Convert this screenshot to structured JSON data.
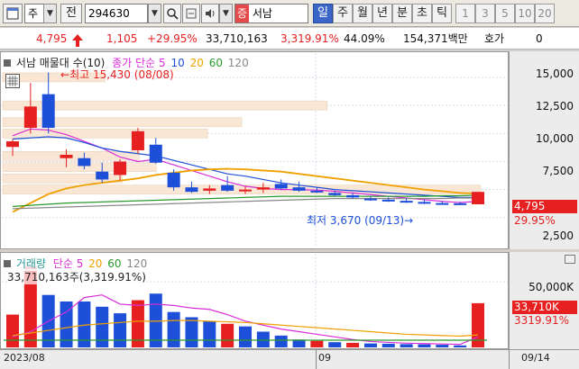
{
  "toolbar": {
    "type_label": "주",
    "history_label": "전",
    "code": "294630",
    "stock_badge": "증",
    "stock_name": "서남",
    "periods": [
      "일",
      "주",
      "월",
      "년",
      "분",
      "초",
      "틱"
    ],
    "active_period": "일",
    "minute_options": [
      "1",
      "3",
      "5",
      "10",
      "20"
    ],
    "icons": [
      "window-icon",
      "search-icon",
      "magnifier-icon",
      "sound-icon"
    ]
  },
  "quote": {
    "price": "4,795",
    "direction": "up",
    "change": "1,105",
    "change_pct": "+29.95%",
    "volume": "33,710,163",
    "volume_ratio": "3,319.91%",
    "turnover_pct": "44.09%",
    "trade_value": "154,371백만",
    "bid_ask_label": "호가",
    "bid_ask_value": "0"
  },
  "colors": {
    "up": "#e62020",
    "down": "#1d4fd8",
    "ma5": "#d82cd8",
    "ma10": "#1d4fd8",
    "ma20": "#f0a000",
    "ma60": "#2a9a2a",
    "ma120": "#888888"
  },
  "price_chart": {
    "legend": {
      "name": "서남 매물대",
      "count_label": "수(10)",
      "ma_prefix": "종가 단순",
      "ma_periods": [
        "5",
        "10",
        "20",
        "60",
        "120"
      ]
    },
    "high_annotation": "최고 15,430 (08/08)",
    "low_annotation": "최저 3,670 (09/13)",
    "y_ticks": [
      "15,000",
      "12,500",
      "10,000",
      "7,500",
      "2,500"
    ],
    "current_price_tag": "4,795",
    "current_pct_tag": "29.95%"
  },
  "volume_chart": {
    "legend": {
      "title": "거래량",
      "ma_prefix": "단순",
      "ma_periods": [
        "5",
        "20",
        "60",
        "120"
      ]
    },
    "info": "33,710,163주(3,319.91%)",
    "y_ticks": [
      "50,000K"
    ],
    "current_volume_tag": "33,710K",
    "current_pct_tag": "3319.91%"
  },
  "date_axis": [
    "2023/08",
    "09",
    "09/14"
  ],
  "chart_data": [
    {
      "type": "candlestick",
      "title": "서남",
      "ylim": [
        0,
        17000
      ],
      "y_ticks": [
        2500,
        5000,
        7500,
        10000,
        12500,
        15000
      ],
      "candles": [
        {
          "o": 8800,
          "h": 9500,
          "l": 8000,
          "c": 9300
        },
        {
          "o": 10500,
          "h": 14500,
          "l": 10000,
          "c": 12400
        },
        {
          "o": 13500,
          "h": 15430,
          "l": 10000,
          "c": 10500
        },
        {
          "o": 7800,
          "h": 8600,
          "l": 7000,
          "c": 8100
        },
        {
          "o": 7800,
          "h": 8300,
          "l": 6800,
          "c": 7100
        },
        {
          "o": 6600,
          "h": 7400,
          "l": 5600,
          "c": 5900
        },
        {
          "o": 6300,
          "h": 7700,
          "l": 5800,
          "c": 7500
        },
        {
          "o": 8500,
          "h": 10500,
          "l": 8200,
          "c": 10200
        },
        {
          "o": 9000,
          "h": 9600,
          "l": 7300,
          "c": 7400
        },
        {
          "o": 6500,
          "h": 6800,
          "l": 4900,
          "c": 5200
        },
        {
          "o": 5200,
          "h": 5700,
          "l": 4700,
          "c": 4800
        },
        {
          "o": 4900,
          "h": 5400,
          "l": 4600,
          "c": 5100
        },
        {
          "o": 5400,
          "h": 6200,
          "l": 4800,
          "c": 4900
        },
        {
          "o": 4900,
          "h": 5300,
          "l": 4600,
          "c": 5000
        },
        {
          "o": 5000,
          "h": 5600,
          "l": 4700,
          "c": 5200
        },
        {
          "o": 5500,
          "h": 5900,
          "l": 5000,
          "c": 5100
        },
        {
          "o": 5200,
          "h": 5700,
          "l": 4800,
          "c": 4900
        },
        {
          "o": 4900,
          "h": 5200,
          "l": 4700,
          "c": 4800
        },
        {
          "o": 4700,
          "h": 4900,
          "l": 4400,
          "c": 4500
        },
        {
          "o": 4500,
          "h": 4700,
          "l": 4200,
          "c": 4300
        },
        {
          "o": 4200,
          "h": 4400,
          "l": 4000,
          "c": 4100
        },
        {
          "o": 4100,
          "h": 4300,
          "l": 3900,
          "c": 4000
        },
        {
          "o": 4000,
          "h": 4200,
          "l": 3800,
          "c": 3900
        },
        {
          "o": 3900,
          "h": 4100,
          "l": 3700,
          "c": 3800
        },
        {
          "o": 3800,
          "h": 4000,
          "l": 3700,
          "c": 3750
        },
        {
          "o": 3780,
          "h": 3900,
          "l": 3670,
          "c": 3690
        },
        {
          "o": 3690,
          "h": 4795,
          "l": 3690,
          "c": 4795
        }
      ],
      "ma": {
        "5": [
          9800,
          10400,
          10300,
          9900,
          9300,
          8700,
          7900,
          7500,
          7700,
          7200,
          6700,
          6200,
          5700,
          5300,
          5100,
          5000,
          5000,
          4950,
          4850,
          4700,
          4550,
          4400,
          4250,
          4100,
          3950,
          3850,
          3950
        ],
        "10": [
          9500,
          9600,
          9700,
          9600,
          9200,
          8700,
          8400,
          8200,
          8000,
          7600,
          7200,
          6800,
          6400,
          6200,
          5900,
          5600,
          5400,
          5200,
          5000,
          4900,
          4800,
          4700,
          4600,
          4500,
          4400,
          4300,
          4300
        ],
        "20": [
          3000,
          3800,
          4600,
          5100,
          5400,
          5600,
          5800,
          6000,
          6300,
          6500,
          6700,
          6800,
          6850,
          6800,
          6700,
          6600,
          6400,
          6200,
          6000,
          5800,
          5600,
          5400,
          5200,
          5000,
          4850,
          4700,
          4650
        ],
        "60": [
          3500,
          3600,
          3700,
          3800,
          3850,
          3900,
          3950,
          4000,
          4050,
          4100,
          4150,
          4200,
          4250,
          4300,
          4350,
          4400,
          4400,
          4400,
          4400,
          4400,
          4400,
          4400,
          4400,
          4400,
          4450,
          4450,
          4500
        ],
        "120": [
          3300,
          3350,
          3400,
          3450,
          3500,
          3550,
          3600,
          3650,
          3700,
          3750,
          3800,
          3850,
          3900,
          3950,
          4000,
          4050,
          4100,
          4150,
          4200,
          4200,
          4200,
          4200,
          4200,
          4200,
          4200,
          4250,
          4250
        ]
      },
      "volume_profile": [
        {
          "price": 15000,
          "vol": 30
        },
        {
          "price": 12500,
          "vol": 95
        },
        {
          "price": 11000,
          "vol": 70
        },
        {
          "price": 10000,
          "vol": 60
        },
        {
          "price": 8000,
          "vol": 40
        },
        {
          "price": 7000,
          "vol": 45
        },
        {
          "price": 6000,
          "vol": 35
        },
        {
          "price": 5000,
          "vol": 140
        }
      ]
    },
    {
      "type": "bar",
      "title": "거래량",
      "ylim": [
        0,
        70000
      ],
      "y_ticks": [
        50000
      ],
      "unit": "K",
      "values": [
        25000,
        62000,
        40000,
        35000,
        35000,
        31000,
        26000,
        36000,
        41000,
        27000,
        23000,
        20000,
        18000,
        16000,
        12000,
        9000,
        6000,
        5000,
        4000,
        3500,
        3000,
        2800,
        2500,
        2300,
        2000,
        1500,
        33710
      ],
      "colors": [
        "up",
        "up",
        "down",
        "down",
        "down",
        "down",
        "down",
        "up",
        "down",
        "down",
        "down",
        "down",
        "up",
        "down",
        "down",
        "down",
        "down",
        "up",
        "down",
        "up",
        "down",
        "down",
        "down",
        "down",
        "down",
        "down",
        "up"
      ],
      "ma": {
        "5": [
          8000,
          12000,
          20000,
          27000,
          38000,
          40000,
          33000,
          32000,
          33000,
          32000,
          30000,
          29000,
          25000,
          20000,
          17000,
          14000,
          12000,
          10000,
          8000,
          6000,
          4500,
          3800,
          3200,
          2900,
          2600,
          2300,
          8000
        ],
        "20": [
          9000,
          11000,
          13000,
          15000,
          17000,
          18000,
          19000,
          20000,
          20000,
          20500,
          20500,
          20000,
          19500,
          19000,
          18000,
          17000,
          16000,
          15000,
          14000,
          13000,
          12000,
          11000,
          10000,
          9500,
          9000,
          8600,
          9500
        ]
      }
    }
  ]
}
